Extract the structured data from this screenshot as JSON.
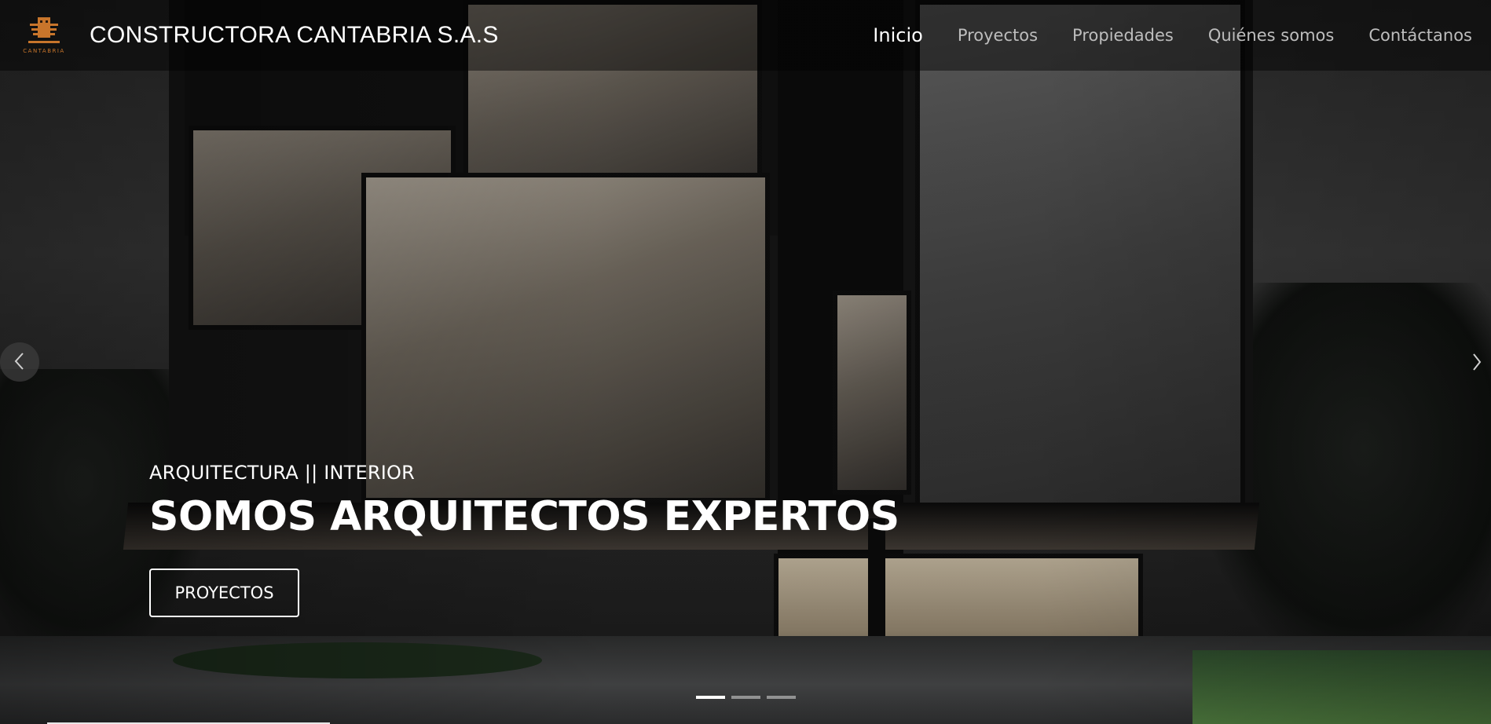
{
  "header": {
    "brand_name": "CONSTRUCTORA CANTABRIA S.A.S",
    "logo_text": "CANTABRIA",
    "brand_color": "#c8752b"
  },
  "nav": {
    "items": [
      {
        "label": "Inicio",
        "active": true
      },
      {
        "label": "Proyectos",
        "active": false
      },
      {
        "label": "Propiedades",
        "active": false
      },
      {
        "label": "Quiénes somos",
        "active": false
      },
      {
        "label": "Contáctanos",
        "active": false
      }
    ]
  },
  "hero": {
    "subtitle": "ARQUITECTURA || INTERIOR",
    "title": "SOMOS ARQUITECTOS EXPERTOS",
    "cta_label": "PROYECTOS"
  },
  "carousel": {
    "prev_icon": "chevron-left-icon",
    "next_icon": "chevron-right-icon",
    "slide_count": 3,
    "active_index": 0
  }
}
